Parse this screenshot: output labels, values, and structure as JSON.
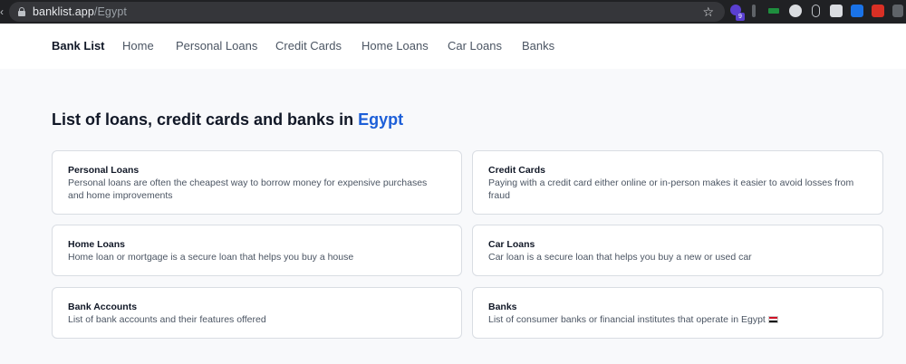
{
  "browser": {
    "url_host": "banklist.app",
    "url_path": "/Egypt",
    "extension_badge": "9"
  },
  "nav": {
    "brand": "Bank List",
    "links": [
      "Home",
      "Personal Loans",
      "Credit Cards",
      "Home Loans",
      "Car Loans",
      "Banks"
    ]
  },
  "page": {
    "heading_prefix": "List of loans, credit cards and banks in",
    "country": "Egypt"
  },
  "cards": [
    {
      "title": "Personal Loans",
      "desc": "Personal loans are often the cheapest way to borrow money for expensive purchases and home improvements"
    },
    {
      "title": "Credit Cards",
      "desc": "Paying with a credit card either online or in-person makes it easier to avoid losses from fraud"
    },
    {
      "title": "Home Loans",
      "desc": "Home loan or mortgage is a secure loan that helps you buy a house"
    },
    {
      "title": "Car Loans",
      "desc": "Car loan is a secure loan that helps you buy a new or used car"
    },
    {
      "title": "Bank Accounts",
      "desc": "List of bank accounts and their features offered"
    },
    {
      "title": "Banks",
      "desc": "List of consumer banks or financial institutes that operate in Egypt"
    }
  ],
  "colors": {
    "accent": "#1d5fd8",
    "page_bg": "#f8f9fb",
    "chrome_bg": "#202124"
  }
}
